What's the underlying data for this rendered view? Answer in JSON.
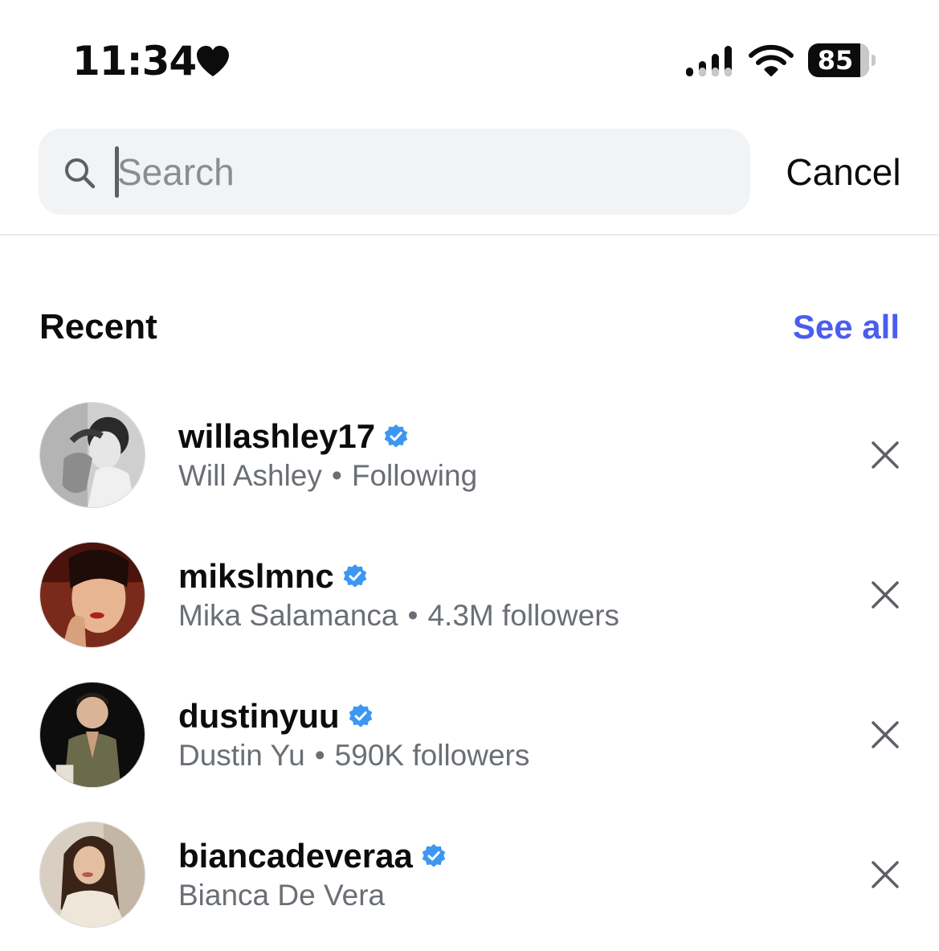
{
  "status_bar": {
    "time": "11:34",
    "battery_level": "85",
    "battery_fraction": 0.85,
    "icons": [
      "heart-icon",
      "cellular-signal-icon",
      "wifi-icon",
      "battery-icon"
    ]
  },
  "search": {
    "placeholder": "Search",
    "value": "",
    "cancel_label": "Cancel"
  },
  "recent": {
    "title": "Recent",
    "see_all_label": "See all",
    "see_all_color": "#4a5df0",
    "items": [
      {
        "username": "willashley17",
        "verified": true,
        "full_name": "Will Ashley",
        "separator": "•",
        "detail": "Following"
      },
      {
        "username": "mikslmnc",
        "verified": true,
        "full_name": "Mika Salamanca",
        "separator": "•",
        "detail": "4.3M followers"
      },
      {
        "username": "dustinyuu",
        "verified": true,
        "full_name": "Dustin Yu",
        "separator": "•",
        "detail": "590K followers"
      },
      {
        "username": "biancadeveraa",
        "verified": true,
        "full_name": "Bianca De Vera",
        "separator": "",
        "detail": ""
      }
    ]
  },
  "colors": {
    "verified_badge": "#3d97f0",
    "secondary_text": "#6a6e75",
    "search_background": "#f2f3f5"
  }
}
